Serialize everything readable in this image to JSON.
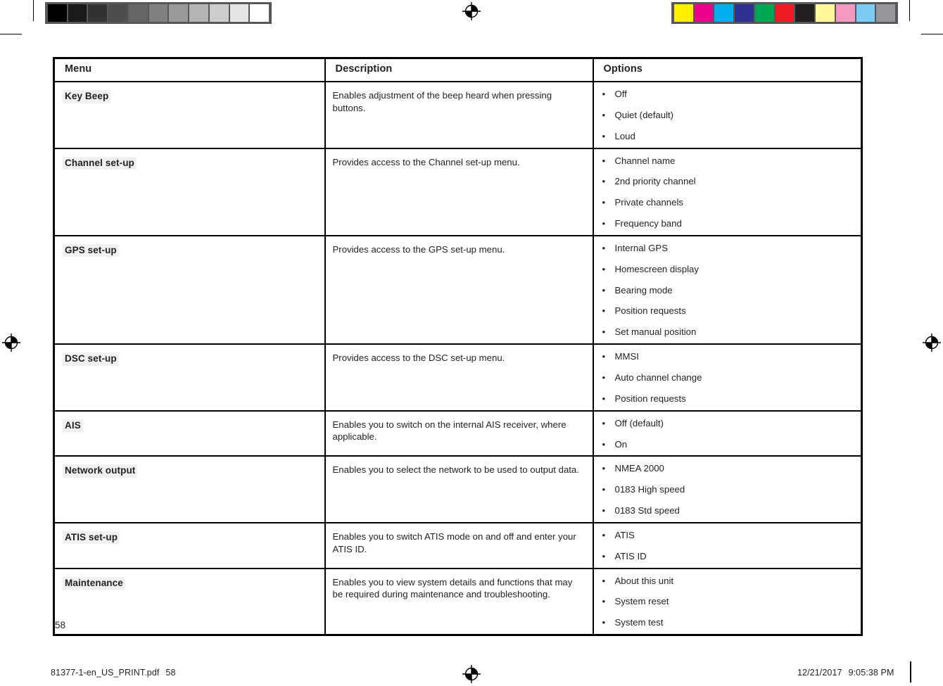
{
  "document": {
    "page_number": "58",
    "footer": {
      "file_name": "81377-1-en_US_PRINT.pdf",
      "file_page": "58",
      "date": "12/21/2017",
      "time": "9:05:38 PM"
    }
  },
  "calibration": {
    "grayscale_patches": [
      "#000000",
      "#1a1a1a",
      "#333333",
      "#4d4d4d",
      "#666666",
      "#808080",
      "#999999",
      "#b3b3b3",
      "#cccccc",
      "#e6e6e6",
      "#ffffff"
    ],
    "color_patches": [
      "#fff000",
      "#ec008c",
      "#00aeef",
      "#2e3192",
      "#00a651",
      "#ed1c24",
      "#231f20",
      "#fff79a",
      "#f49ac1",
      "#7accf4",
      "#939598"
    ],
    "strip_background": "#58585a"
  },
  "table": {
    "headers": {
      "menu": "Menu",
      "description": "Description",
      "options": "Options"
    },
    "bullet": "•",
    "highlight_color": "#f0f0f0",
    "border_color": "#000000",
    "rows": [
      {
        "menu": "Key Beep",
        "description": "Enables adjustment of the beep heard when pressing buttons.",
        "options": [
          "Off",
          "Quiet (default)",
          "Loud"
        ]
      },
      {
        "menu": "Channel set-up",
        "description": "Provides access to the Channel set-up menu.",
        "options": [
          "Channel name",
          "2nd priority channel",
          "Private channels",
          "Frequency band"
        ]
      },
      {
        "menu": "GPS set-up",
        "description": "Provides access to the GPS set-up menu.",
        "options": [
          "Internal GPS",
          "Homescreen display",
          "Bearing mode",
          "Position requests",
          "Set manual position"
        ]
      },
      {
        "menu": "DSC set-up",
        "description": "Provides access to the DSC set-up menu.",
        "options": [
          "MMSI",
          "Auto channel change",
          "Position requests"
        ]
      },
      {
        "menu": "AIS",
        "description": "Enables you to switch on the internal AIS receiver, where applicable.",
        "options": [
          "Off (default)",
          "On"
        ]
      },
      {
        "menu": "Network output",
        "description": "Enables you to select the network to be used to output data.",
        "options": [
          "NMEA 2000",
          "0183 High speed",
          "0183 Std speed"
        ]
      },
      {
        "menu": "ATIS set-up",
        "description": "Enables you to switch ATIS mode on and off and enter your ATIS ID.",
        "options": [
          "ATIS",
          "ATIS ID"
        ]
      },
      {
        "menu": "Maintenance",
        "description": "Enables you to view system details and functions that may be required during maintenance and troubleshooting.",
        "options": [
          "About this unit",
          "System reset",
          "System test"
        ]
      }
    ]
  }
}
